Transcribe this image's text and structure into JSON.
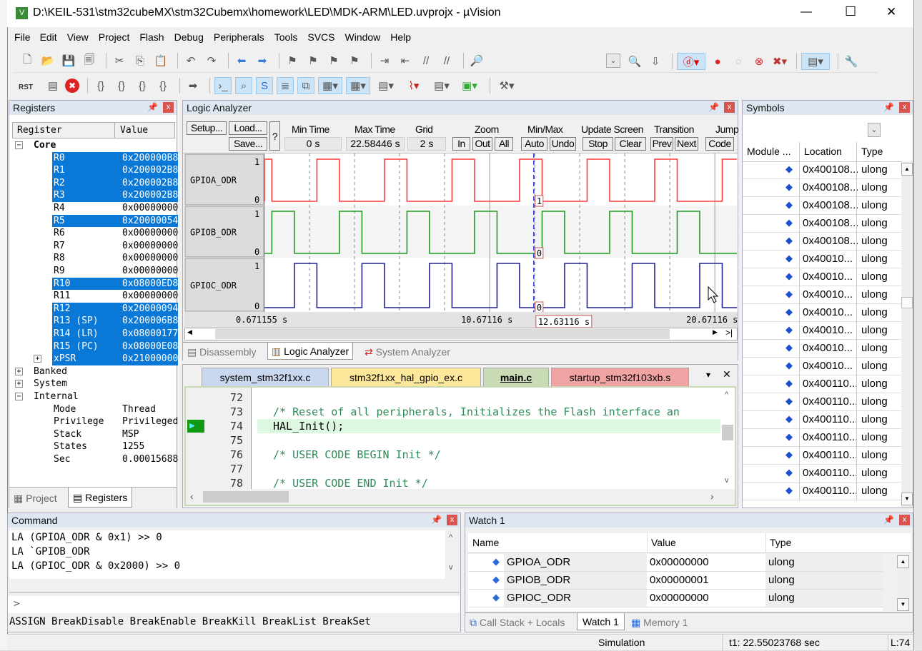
{
  "window": {
    "title": "D:\\KEIL-531\\stm32cubeMX\\stm32Cubemx\\homework\\LED\\MDK-ARM\\LED.uvprojx - µVision",
    "minimize": "—",
    "maximize": "☐",
    "close": "✕"
  },
  "menu": [
    "File",
    "Edit",
    "View",
    "Project",
    "Flash",
    "Debug",
    "Peripherals",
    "Tools",
    "SVCS",
    "Window",
    "Help"
  ],
  "toolbar1_icons": [
    "new-file",
    "open",
    "save",
    "save-all",
    "cut",
    "copy",
    "paste",
    "undo",
    "redo",
    "nav-back",
    "nav-forward",
    "bookmark",
    "prev-bookmark",
    "next-bookmark",
    "clear-bookmarks",
    "indent",
    "unindent",
    "comment",
    "uncomment",
    "find-in-files"
  ],
  "toolbar2": {
    "rst": "RST"
  },
  "registers": {
    "title": "Registers",
    "col_register": "Register",
    "col_value": "Value",
    "core_label": "Core",
    "core": [
      {
        "name": "R0",
        "value": "0x200000B8",
        "sel": true
      },
      {
        "name": "R1",
        "value": "0x200002B8",
        "sel": true
      },
      {
        "name": "R2",
        "value": "0x200002B8",
        "sel": true
      },
      {
        "name": "R3",
        "value": "0x200002B8",
        "sel": true
      },
      {
        "name": "R4",
        "value": "0x00000000",
        "sel": false
      },
      {
        "name": "R5",
        "value": "0x20000054",
        "sel": true
      },
      {
        "name": "R6",
        "value": "0x00000000",
        "sel": false
      },
      {
        "name": "R7",
        "value": "0x00000000",
        "sel": false
      },
      {
        "name": "R8",
        "value": "0x00000000",
        "sel": false
      },
      {
        "name": "R9",
        "value": "0x00000000",
        "sel": false
      },
      {
        "name": "R10",
        "value": "0x08000ED8",
        "sel": true
      },
      {
        "name": "R11",
        "value": "0x00000000",
        "sel": false
      },
      {
        "name": "R12",
        "value": "0x20000094",
        "sel": true
      },
      {
        "name": "R13 (SP)",
        "value": "0x200006B8",
        "sel": true
      },
      {
        "name": "R14 (LR)",
        "value": "0x08000177",
        "sel": true
      },
      {
        "name": "R15 (PC)",
        "value": "0x08000E08",
        "sel": true
      },
      {
        "name": "xPSR",
        "value": "0x21000000",
        "sel": true
      }
    ],
    "groups": [
      "Banked",
      "System",
      "Internal"
    ],
    "internal": [
      {
        "name": "Mode",
        "value": "Thread"
      },
      {
        "name": "Privilege",
        "value": "Privileged"
      },
      {
        "name": "Stack",
        "value": "MSP"
      },
      {
        "name": "States",
        "value": "1255"
      },
      {
        "name": "Sec",
        "value": "0.00015688"
      }
    ],
    "tabs": [
      "Project",
      "Registers"
    ]
  },
  "logic": {
    "title": "Logic Analyzer",
    "setup": "Setup...",
    "load": "Load...",
    "save": "Save...",
    "help": "?",
    "min_time_label": "Min Time",
    "min_time": "0 s",
    "max_time_label": "Max Time",
    "max_time": "22.58446 s",
    "grid_label": "Grid",
    "grid": "2 s",
    "zoom_label": "Zoom",
    "zoom_in": "In",
    "zoom_out": "Out",
    "zoom_all": "All",
    "minmax_label": "Min/Max",
    "auto": "Auto",
    "undo": "Undo",
    "update_label": "Update Screen",
    "stop": "Stop",
    "clear": "Clear",
    "transition_label": "Transition",
    "prev": "Prev",
    "next": "Next",
    "jump_label": "Jump",
    "code": "Code",
    "cursor_time": "12.63116 s",
    "axis_labels": [
      "0.671155 s",
      "10.67116 s",
      "20.67116 s"
    ],
    "cursor_values": [
      "1",
      "0",
      "0"
    ],
    "tabs": [
      "Disassembly",
      "Logic Analyzer",
      "System Analyzer"
    ]
  },
  "chart_data": {
    "type": "line",
    "step": true,
    "xlim": [
      0.671155,
      21.65
    ],
    "grid_interval_s": 2,
    "cursor_s": 12.63116,
    "series": [
      {
        "name": "GPIOA_ODR",
        "color": "#ff3b3b",
        "ymin": "0",
        "ymax": "1",
        "high_intervals": [
          [
            0,
            1
          ],
          [
            3,
            4
          ],
          [
            6,
            7
          ],
          [
            9,
            10
          ],
          [
            12,
            13
          ],
          [
            15,
            16
          ],
          [
            18,
            19
          ],
          [
            21,
            22.58
          ]
        ]
      },
      {
        "name": "GPIOB_ODR",
        "color": "#229922",
        "ymin": "0",
        "ymax": "1",
        "high_intervals": [
          [
            1,
            2
          ],
          [
            4,
            5
          ],
          [
            7,
            8
          ],
          [
            10,
            11
          ],
          [
            13,
            14
          ],
          [
            16,
            17
          ],
          [
            19,
            20
          ]
        ]
      },
      {
        "name": "GPIOC_ODR",
        "color": "#22228f",
        "ymin": "0",
        "ymax": "1",
        "high_intervals": [
          [
            2,
            3
          ],
          [
            5,
            6
          ],
          [
            8,
            9
          ],
          [
            11,
            12
          ],
          [
            14,
            15
          ],
          [
            17,
            18
          ],
          [
            20,
            21
          ]
        ]
      }
    ]
  },
  "editor": {
    "tabs": [
      "system_stm32f1xx.c",
      "stm32f1xx_hal_gpio_ex.c",
      "main.c",
      "startup_stm32f103xb.s"
    ],
    "lines": [
      {
        "n": "72",
        "code": "",
        "comment": false
      },
      {
        "n": "73",
        "code": "/* Reset of all peripherals, Initializes the Flash interface an",
        "comment": true
      },
      {
        "n": "74",
        "code": "HAL_Init();",
        "comment": false,
        "current": true
      },
      {
        "n": "75",
        "code": "",
        "comment": false
      },
      {
        "n": "76",
        "code": "/* USER CODE BEGIN Init */",
        "comment": true
      },
      {
        "n": "77",
        "code": "",
        "comment": false
      },
      {
        "n": "78",
        "code": "/* USER CODE END Init */",
        "comment": true
      }
    ]
  },
  "symbols": {
    "title": "Symbols",
    "col_module": "Module ...",
    "col_location": "Location",
    "col_type": "Type",
    "rows": [
      [
        "0x400108...",
        "ulong"
      ],
      [
        "0x400108...",
        "ulong"
      ],
      [
        "0x400108...",
        "ulong"
      ],
      [
        "0x400108...",
        "ulong"
      ],
      [
        "0x400108...",
        "ulong"
      ],
      [
        "0x40010...",
        "ulong"
      ],
      [
        "0x40010...",
        "ulong"
      ],
      [
        "0x40010...",
        "ulong"
      ],
      [
        "0x40010...",
        "ulong"
      ],
      [
        "0x40010...",
        "ulong"
      ],
      [
        "0x40010...",
        "ulong"
      ],
      [
        "0x40010...",
        "ulong"
      ],
      [
        "0x400110...",
        "ulong"
      ],
      [
        "0x400110...",
        "ulong"
      ],
      [
        "0x400110...",
        "ulong"
      ],
      [
        "0x400110...",
        "ulong"
      ],
      [
        "0x400110...",
        "ulong"
      ],
      [
        "0x400110...",
        "ulong"
      ],
      [
        "0x400110...",
        "ulong"
      ]
    ]
  },
  "command": {
    "title": "Command",
    "lines": [
      "LA (GPIOA_ODR & 0x1) >> 0",
      "LA `GPIOB_ODR",
      "LA (GPIOC_ODR & 0x2000) >> 0"
    ],
    "prompt": ">",
    "hints": "ASSIGN BreakDisable BreakEnable BreakKill BreakList BreakSet"
  },
  "watch": {
    "title": "Watch 1",
    "col_name": "Name",
    "col_value": "Value",
    "col_type": "Type",
    "rows": [
      {
        "name": "GPIOA_ODR",
        "value": "0x00000000",
        "type": "ulong"
      },
      {
        "name": "GPIOB_ODR",
        "value": "0x00000001",
        "type": "ulong"
      },
      {
        "name": "GPIOC_ODR",
        "value": "0x00000000",
        "type": "ulong"
      }
    ],
    "tabs": [
      "Call Stack + Locals",
      "Watch 1",
      "Memory 1"
    ]
  },
  "status": {
    "mode": "Simulation",
    "time": "t1: 22.55023768 sec",
    "line": "L:74"
  }
}
